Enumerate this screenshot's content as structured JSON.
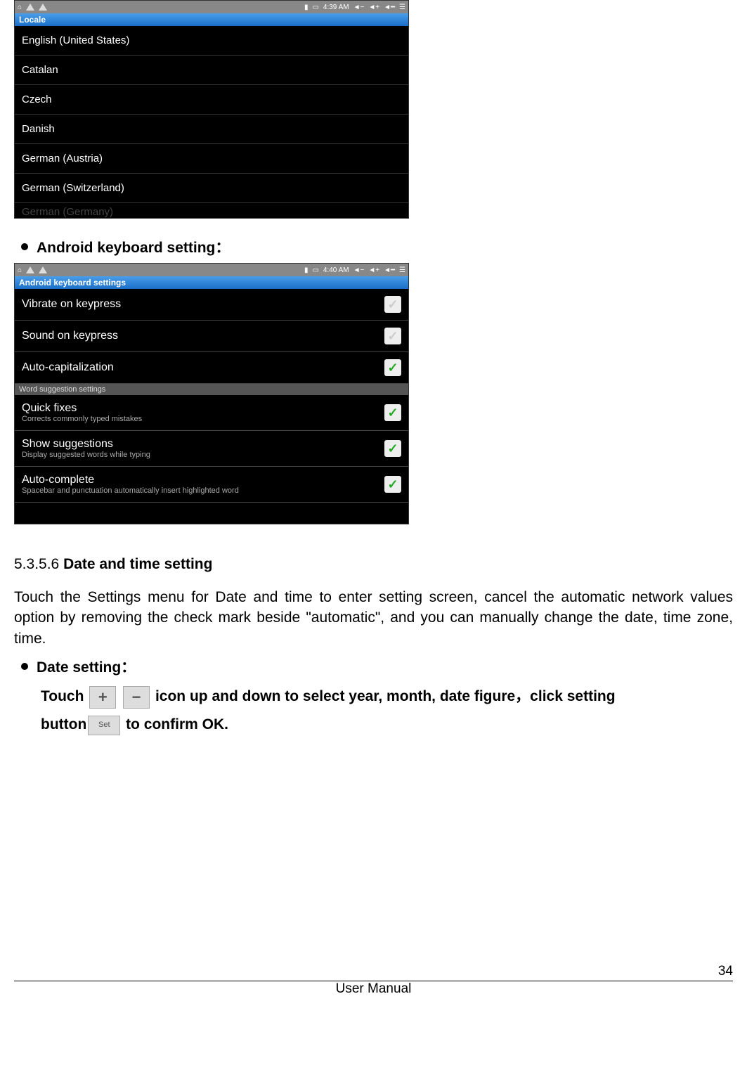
{
  "screenshot1": {
    "time": "4:39 AM",
    "titlebar": "Locale",
    "items": [
      "English (United States)",
      "Catalan",
      "Czech",
      "Danish",
      "German (Austria)",
      "German (Switzerland)"
    ],
    "truncated": "German (Germany)"
  },
  "heading_keyboard": "Android keyboard setting：",
  "screenshot2": {
    "time": "4:40 AM",
    "titlebar": "Android keyboard settings",
    "rows": [
      {
        "title": "Vibrate on keypress",
        "sub": "",
        "checked": false
      },
      {
        "title": "Sound on keypress",
        "sub": "",
        "checked": false
      },
      {
        "title": "Auto-capitalization",
        "sub": "",
        "checked": true
      }
    ],
    "section_header": "Word suggestion settings",
    "rows2": [
      {
        "title": "Quick fixes",
        "sub": "Corrects commonly typed mistakes",
        "checked": true
      },
      {
        "title": "Show suggestions",
        "sub": "Display suggested words while typing",
        "checked": true
      },
      {
        "title": "Auto-complete",
        "sub": "Spacebar and punctuation automatically insert highlighted word",
        "checked": true
      }
    ]
  },
  "section": {
    "number": "5.3.5.6 ",
    "title": "Date and time setting"
  },
  "body_para": "Touch the Settings menu for Date and time to enter setting screen, cancel the automatic network values option by removing the check mark beside \"automatic\", and you can manually change the date, time zone, time.",
  "date_heading": "Date setting：",
  "date_line_1a": "Touch ",
  "date_line_1b": " icon up and down to select year, month, date figure，click setting",
  "date_line_2a": "button",
  "date_line_2b": " to confirm OK.",
  "set_label": "Set",
  "footer": {
    "page": "34",
    "label": "User Manual"
  }
}
